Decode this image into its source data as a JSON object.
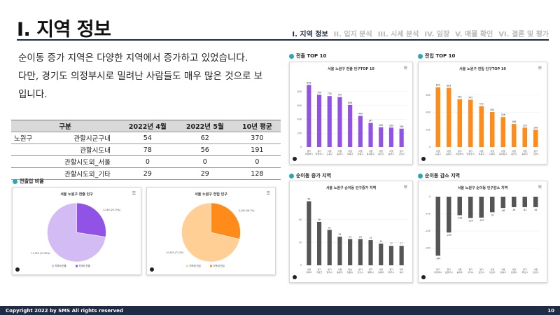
{
  "header": {
    "title": "I. 지역 정보",
    "nav": [
      "I. 지역 정보",
      "II. 입지 분석",
      "III. 시세 분석",
      "IV. 임장",
      "V. 매물 확인",
      "VI. 결론 및 평가"
    ]
  },
  "description": {
    "line1": "순이동 증가 지역은 다양한 지역에서 증가하고 있었습니다.",
    "line2": "다만, 경기도 의정부시로 밀려난 사람들도 매우 많은 것으로 보입니다."
  },
  "table": {
    "headers": [
      "구분",
      "2022년 4월",
      "2022년 5월",
      "10년 평균"
    ],
    "rows": [
      {
        "gu": "노원구",
        "cat": "관할시군구내",
        "apr": "54",
        "may": "62",
        "avg": "370"
      },
      {
        "gu": "",
        "cat": "관할시도내",
        "apr": "78",
        "may": "56",
        "avg": "191"
      },
      {
        "gu": "",
        "cat": "관할시도외_서울",
        "apr": "0",
        "may": "0",
        "avg": "0"
      },
      {
        "gu": "",
        "cat": "관할시도외_기타",
        "apr": "29",
        "may": "29",
        "avg": "128"
      }
    ]
  },
  "sections": {
    "pie": "전출입 비율",
    "out_top": "전출 TOP 10",
    "in_top": "전입 TOP 10",
    "net_inc": "순이동 증가 지역",
    "net_dec": "순이동 감소 지역"
  },
  "colors": {
    "purple": "#9152e6",
    "purple_light": "#d3bcf4",
    "orange": "#ff8c1a",
    "orange_light": "#ffcf96",
    "gray": "#555555",
    "nav_active": "#1f2a44"
  },
  "chart_data": [
    {
      "type": "pie",
      "title": "서울 노원구 전출 인구",
      "slices": [
        {
          "name": "지역내 전출",
          "value": 11220,
          "label": "11,220 (74.25%)"
        },
        {
          "name": "지역외 전출",
          "value": 4249,
          "label": "4,249 (25.75%)"
        }
      ]
    },
    {
      "type": "pie",
      "title": "서울 노원구 전입 인구",
      "slices": [
        {
          "name": "지역외 전입",
          "value": 10543,
          "label": "10,543 (71.3%)"
        },
        {
          "name": "지역내 전입",
          "value": 4244,
          "label": "4,244 (28.7%)"
        }
      ]
    },
    {
      "type": "bar",
      "title": "서울 노원구 전출 인구TOP 10",
      "categories": [
        "경기 의정부시",
        "경기 남양주시",
        "서울 도봉구",
        "서울 중랑구",
        "서울 성북구",
        "서울 강북구",
        "서울 동대문구",
        "서울 광진구",
        "서울 송파구",
        "경기 고양시"
      ],
      "values": [
        896,
        754,
        735,
        720,
        608,
        449,
        347,
        285,
        280,
        265
      ],
      "ylim": [
        0,
        1000
      ],
      "ticks": [
        "800",
        "600",
        "400",
        "200",
        "0"
      ]
    },
    {
      "type": "bar",
      "title": "서울 노원구 전입 인구TOP 10",
      "categories": [
        "서울 도봉구",
        "서울 중랑구",
        "경기 의정부시",
        "경기 남양주시",
        "서울 성북구",
        "서울 강북구",
        "서울 동대문구",
        "서울 광진구",
        "서울 송파구",
        "경기 고양시"
      ],
      "values": [
        690,
        683,
        552,
        545,
        472,
        404,
        346,
        266,
        224,
        198
      ],
      "ylim": [
        0,
        800
      ],
      "ticks": [
        "600",
        "400",
        "200",
        "0"
      ]
    },
    {
      "type": "bar",
      "title": "서울 노원구 순이동 인구증가 지역",
      "categories": [
        "서울 강북구",
        "경기 가평군",
        "경기 양주시",
        "서울 중랑구",
        "경남 창원시",
        "경기 안산시",
        "경기 평택시",
        "서울 성북구",
        "경기 파주시",
        "대구 북구"
      ],
      "values": [
        56,
        38,
        31,
        25,
        23,
        23,
        22,
        19,
        17,
        17
      ],
      "ylim": [
        0,
        60
      ],
      "ticks": [
        "40",
        "20",
        "0"
      ]
    },
    {
      "type": "bar",
      "title": "서울 노원구 순이동 인구감소 지역",
      "categories": [
        "경기 의정부시",
        "경기 남양주시",
        "서울 송파구",
        "경기 구리시",
        "경기 포천시",
        "서울 강남구",
        "서울 강동구",
        "서울 은평구",
        "경기 하남시",
        "서울 강남구"
      ],
      "values": [
        -344,
        -209,
        -108,
        -124,
        -122,
        -91,
        -66,
        -61,
        -61,
        -61
      ],
      "ylim": [
        -400,
        0
      ],
      "ticks": [
        "0",
        "-100",
        "-200",
        "-300"
      ]
    }
  ],
  "footer": {
    "copyright": "Copyright 2022 by SMS All rights reserved",
    "page": "10"
  }
}
